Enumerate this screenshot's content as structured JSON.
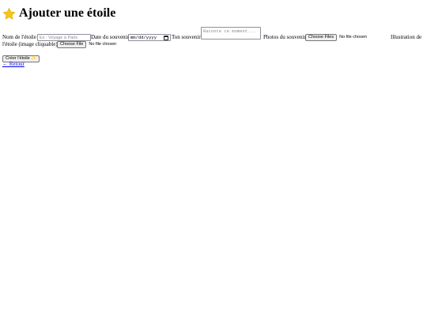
{
  "header": {
    "title": "Ajouter une étoile",
    "icon": "star-icon"
  },
  "form": {
    "name_label": "Nom de l'étoile",
    "name_placeholder": "Ex : Voyage à Paris",
    "date_label": "Date du souvenir",
    "date_placeholder": "mm/dd/yyyy",
    "memory_label": "Ton souvenir",
    "memory_placeholder": "Raconte ce moment...",
    "photos_label": "Photos du souvenir",
    "photos_button": "Choose Files",
    "photos_status": "No file chosen",
    "illustration_label_line1": "Illustration de",
    "illustration_label_line2": "l'étoile (image cliquable)",
    "illustration_button": "Choose File",
    "illustration_status": "No file chosen",
    "submit_label": "Créer l'étoile ✨"
  },
  "nav": {
    "back_label": "← Retour"
  },
  "colors": {
    "link": "#0000ee",
    "star": "#f5c518"
  }
}
